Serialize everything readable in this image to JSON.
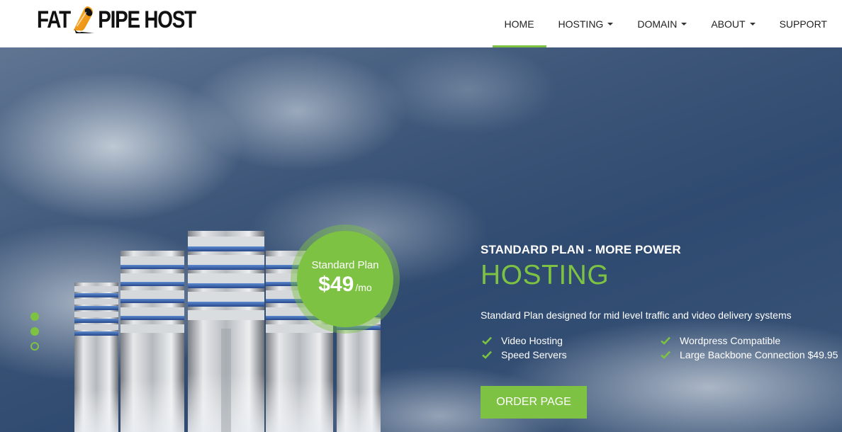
{
  "brand": {
    "name_part1": "FAT",
    "name_part2": "PIPE HOST",
    "accent_color": "#7dc242"
  },
  "nav": {
    "items": [
      {
        "label": "HOME",
        "active": true,
        "dropdown": false
      },
      {
        "label": "HOSTING",
        "active": false,
        "dropdown": true
      },
      {
        "label": "DOMAIN",
        "active": false,
        "dropdown": true
      },
      {
        "label": "ABOUT",
        "active": false,
        "dropdown": true
      },
      {
        "label": "SUPPORT",
        "active": false,
        "dropdown": false
      }
    ]
  },
  "slider": {
    "dots": [
      {
        "state": "filled"
      },
      {
        "state": "filled"
      },
      {
        "state": "hollow"
      }
    ]
  },
  "badge": {
    "label": "Standard Plan",
    "price": "$49",
    "period": "/mo"
  },
  "hero": {
    "subtitle": "STANDARD PLAN - MORE POWER",
    "title": "HOSTING",
    "description": "Standard Plan designed for mid level traffic and video delivery systems",
    "features": [
      "Video Hosting",
      "Wordpress Compatible",
      "Speed Servers",
      "Large Backbone Connection $49.95"
    ],
    "cta_label": "ORDER PAGE"
  },
  "icons": {
    "feature_bullet": "check-icon",
    "nav_dropdown": "caret-down-icon"
  }
}
